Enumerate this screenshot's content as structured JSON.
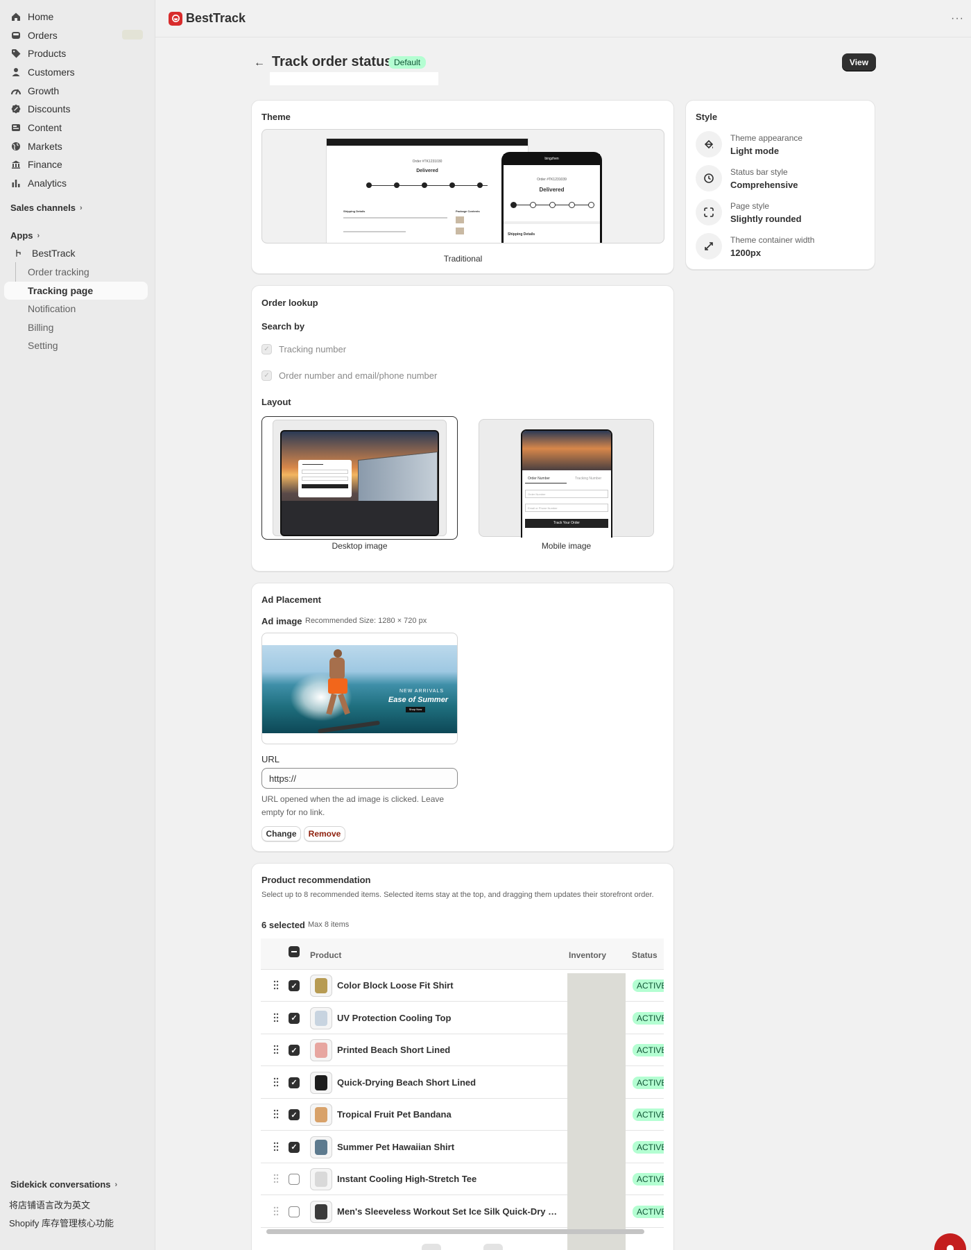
{
  "app": {
    "name": "BestTrack"
  },
  "sidebar": {
    "nav": [
      {
        "label": "Home",
        "icon": "home-icon"
      },
      {
        "label": "Orders",
        "icon": "inbox-icon"
      },
      {
        "label": "Products",
        "icon": "tag-icon"
      },
      {
        "label": "Customers",
        "icon": "person-icon"
      },
      {
        "label": "Growth",
        "icon": "growth-icon"
      },
      {
        "label": "Discounts",
        "icon": "discount-icon"
      },
      {
        "label": "Content",
        "icon": "content-icon"
      },
      {
        "label": "Markets",
        "icon": "globe-icon"
      },
      {
        "label": "Finance",
        "icon": "bank-icon"
      },
      {
        "label": "Analytics",
        "icon": "bar-chart-icon"
      }
    ],
    "sales_channels": "Sales channels",
    "apps": "Apps",
    "app_name": "BestTrack",
    "app_items": [
      "Order tracking",
      "Tracking page",
      "Notification",
      "Billing",
      "Setting"
    ],
    "sidekick": "Sidekick conversations",
    "conversations": [
      "将店铺语言改为英文",
      "Shopify 库存管理核心功能"
    ]
  },
  "page": {
    "title": "Track order status",
    "badge": "Default",
    "view_button": "View"
  },
  "theme_card": {
    "title": "Theme",
    "caption": "Traditional",
    "preview": {
      "order_label": "Order #TK1231030",
      "status": "Delivered",
      "shipping_details": "Shipping Details",
      "package_contents": "Package Contents",
      "mobile_brand": "bingzhen",
      "mobile_order": "Order #TK1231039"
    }
  },
  "style_card": {
    "title": "Style",
    "rows": [
      {
        "label": "Theme appearance",
        "value": "Light mode",
        "icon": "paint-bucket-icon"
      },
      {
        "label": "Status bar style",
        "value": "Comprehensive",
        "icon": "clock-icon"
      },
      {
        "label": "Page style",
        "value": "Slightly rounded",
        "icon": "rounded-corners-icon"
      },
      {
        "label": "Theme container width",
        "value": "1200px",
        "icon": "expand-icon"
      }
    ]
  },
  "lookup_card": {
    "title": "Order lookup",
    "search_by": "Search by",
    "options": [
      "Tracking number",
      "Order number and email/phone number"
    ],
    "layout": "Layout",
    "desktop_caption": "Desktop image",
    "mobile_caption": "Mobile image",
    "mobile_preview": {
      "tab1": "Order Number",
      "tab2": "Tracking Number",
      "field1": "Order Number",
      "field2": "Email or Phone Number",
      "button": "Track Your Order"
    }
  },
  "ad_card": {
    "title": "Ad Placement",
    "image_label": "Ad image",
    "recommended": "Recommended Size: 1280 × 720 px",
    "banner": {
      "line1": "NEW ARRIVALS",
      "line2": "Ease of Summer",
      "cta": "Shop Now"
    },
    "url_label": "URL",
    "url_value": "https://",
    "help": "URL opened when the ad image is clicked. Leave empty for no link.",
    "change": "Change",
    "remove": "Remove"
  },
  "recommend_card": {
    "title": "Product recommendation",
    "desc": "Select up to 8 recommended items. Selected items stay at the top, and dragging them updates their storefront order.",
    "selected": "6 selected",
    "max": "Max 8 items",
    "columns": {
      "product": "Product",
      "inventory": "Inventory",
      "status": "Status"
    },
    "rows": [
      {
        "name": "Color Block Loose Fit Shirt",
        "checked": true,
        "status": "ACTIVE"
      },
      {
        "name": "UV Protection Cooling Top",
        "checked": true,
        "status": "ACTIVE"
      },
      {
        "name": "Printed Beach Short Lined",
        "checked": true,
        "status": "ACTIVE"
      },
      {
        "name": "Quick-Drying Beach Short Lined",
        "checked": true,
        "status": "ACTIVE"
      },
      {
        "name": "Tropical Fruit Pet Bandana",
        "checked": true,
        "status": "ACTIVE"
      },
      {
        "name": "Summer Pet Hawaiian Shirt",
        "checked": true,
        "status": "ACTIVE"
      },
      {
        "name": "Instant Cooling High-Stretch Tee",
        "checked": false,
        "status": "ACTIVE"
      },
      {
        "name": "Men's Sleeveless Workout Set Ice Silk Quick-Dry Su...",
        "checked": false,
        "status": "ACTIVE"
      }
    ]
  },
  "colors": {
    "accent": "#303030",
    "success_bg": "#b4fed2",
    "success_text": "#0c5132",
    "brand_red": "#d82c2c",
    "critical": "#8e1f0b"
  }
}
